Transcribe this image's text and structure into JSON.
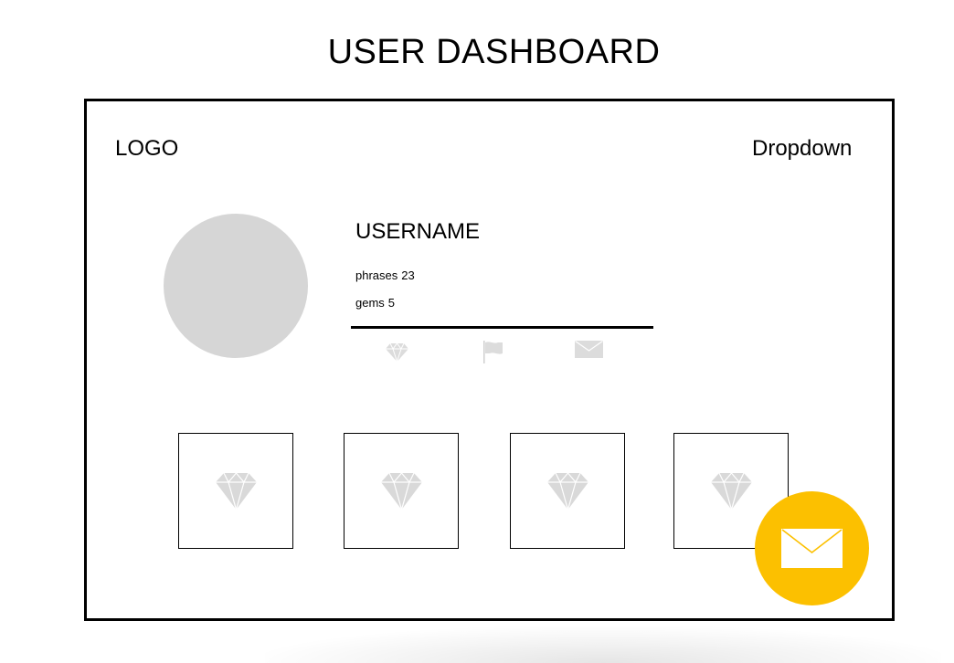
{
  "page": {
    "title": "USER DASHBOARD"
  },
  "header": {
    "logo": "LOGO",
    "dropdown": "Dropdown"
  },
  "profile": {
    "username": "USERNAME",
    "stats": {
      "phrases_label": "phrases",
      "phrases_value": "23",
      "gems_label": "gems",
      "gems_value": "5"
    },
    "actions": [
      {
        "icon": "gem-icon"
      },
      {
        "icon": "flag-icon"
      },
      {
        "icon": "mail-icon"
      }
    ]
  },
  "gem_tiles": [
    {
      "icon": "gem-icon"
    },
    {
      "icon": "gem-icon"
    },
    {
      "icon": "gem-icon"
    },
    {
      "icon": "gem-icon"
    }
  ],
  "fab": {
    "icon": "mail-icon",
    "color": "#fcc000"
  },
  "colors": {
    "avatar_placeholder": "#d6d6d6",
    "icon_gray": "#d9d9d9",
    "border": "#000000"
  }
}
